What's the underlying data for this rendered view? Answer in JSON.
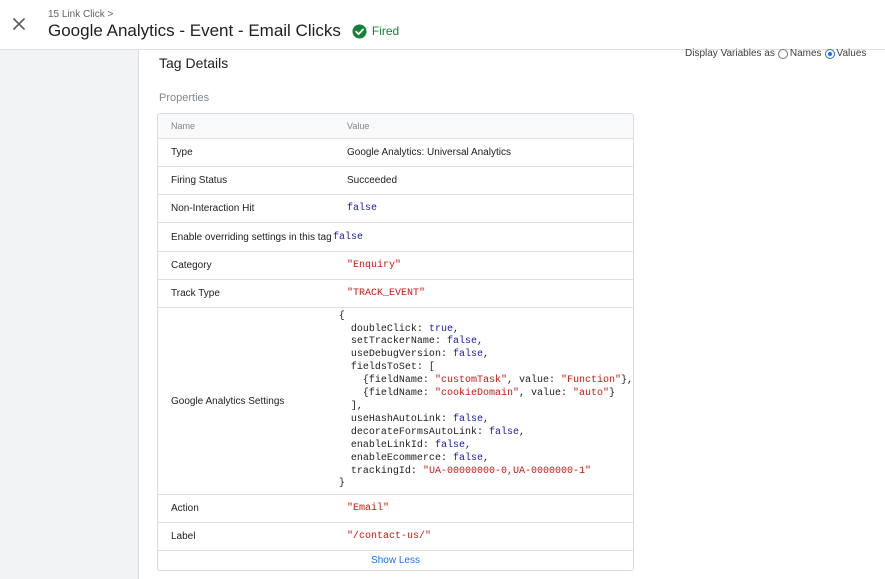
{
  "header": {
    "breadcrumb": "15 Link Click >",
    "title": "Google Analytics - Event - Email Clicks",
    "status": "Fired",
    "status_color": "#188038",
    "close_icon": "close-icon",
    "status_icon": "check-circle-icon"
  },
  "display_variables": {
    "label": "Display Variables as",
    "option_names": "Names",
    "option_values": "Values",
    "selected": "Values"
  },
  "section_title": "Tag Details",
  "properties_label": "Properties",
  "table": {
    "headers": {
      "name": "Name",
      "value": "Value"
    },
    "rows": {
      "type": {
        "name": "Type",
        "value": "Google Analytics: Universal Analytics"
      },
      "firing_status": {
        "name": "Firing Status",
        "value": "Succeeded"
      },
      "non_interaction": {
        "name": "Non-Interaction Hit",
        "value": "false"
      },
      "override": {
        "name": "Enable overriding settings in this tag",
        "value": "false"
      },
      "category": {
        "name": "Category",
        "value": "\"Enquiry\""
      },
      "track_type": {
        "name": "Track Type",
        "value": "\"TRACK_EVENT\""
      },
      "ga_settings": {
        "name": "Google Analytics Settings",
        "lines": [
          [
            [
              "{",
              "plain"
            ]
          ],
          [
            [
              "  doubleClick: ",
              "plain"
            ],
            [
              "true",
              "kw"
            ],
            [
              ",",
              "plain"
            ]
          ],
          [
            [
              "  setTrackerName: ",
              "plain"
            ],
            [
              "false",
              "kw"
            ],
            [
              ",",
              "plain"
            ]
          ],
          [
            [
              "  useDebugVersion: ",
              "plain"
            ],
            [
              "false",
              "kw"
            ],
            [
              ",",
              "plain"
            ]
          ],
          [
            [
              "  fieldsToSet: [",
              "plain"
            ]
          ],
          [
            [
              "    {fieldName: ",
              "plain"
            ],
            [
              "\"customTask\"",
              "str"
            ],
            [
              ", value: ",
              "plain"
            ],
            [
              "\"Function\"",
              "str"
            ],
            [
              "},",
              "plain"
            ]
          ],
          [
            [
              "    {fieldName: ",
              "plain"
            ],
            [
              "\"cookieDomain\"",
              "str"
            ],
            [
              ", value: ",
              "plain"
            ],
            [
              "\"auto\"",
              "str"
            ],
            [
              "}",
              "plain"
            ]
          ],
          [
            [
              "  ],",
              "plain"
            ]
          ],
          [
            [
              "  useHashAutoLink: ",
              "plain"
            ],
            [
              "false",
              "kw"
            ],
            [
              ",",
              "plain"
            ]
          ],
          [
            [
              "  decorateFormsAutoLink: ",
              "plain"
            ],
            [
              "false",
              "kw"
            ],
            [
              ",",
              "plain"
            ]
          ],
          [
            [
              "  enableLinkId: ",
              "plain"
            ],
            [
              "false",
              "kw"
            ],
            [
              ",",
              "plain"
            ]
          ],
          [
            [
              "  enableEcommerce: ",
              "plain"
            ],
            [
              "false",
              "kw"
            ],
            [
              ",",
              "plain"
            ]
          ],
          [
            [
              "  trackingId: ",
              "plain"
            ],
            [
              "\"UA-00000000-0,UA-0000000-1\"",
              "str"
            ]
          ],
          [
            [
              "}",
              "plain"
            ]
          ]
        ]
      },
      "action": {
        "name": "Action",
        "value": "\"Email\""
      },
      "label": {
        "name": "Label",
        "value": "\"/contact-us/\""
      }
    },
    "show_less": "Show Less"
  },
  "colors": {
    "accent": "#1a73e8",
    "keyword": "#1a1aa6",
    "string": "#c41a16"
  }
}
